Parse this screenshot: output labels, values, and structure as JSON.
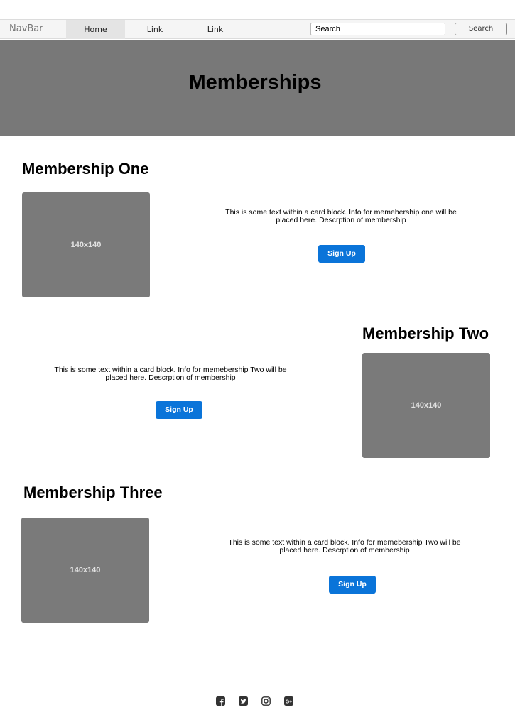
{
  "navbar": {
    "brand": "NavBar",
    "items": [
      {
        "label": "Home"
      },
      {
        "label": "Link"
      },
      {
        "label": "Link"
      }
    ],
    "search_placeholder": "Search",
    "search_button": "Search"
  },
  "hero": {
    "title": "Memberships"
  },
  "memberships": [
    {
      "title": "Membership One",
      "image_label": "140x140",
      "text": "This is some text within a card block. Info for memebership one will be placed here. Descrption of membership",
      "button": "Sign Up"
    },
    {
      "title": "Membership Two",
      "image_label": "140x140",
      "text": "This is some text within a card block. Info for memebership Two will be placed here. Descrption of membership",
      "button": "Sign Up"
    },
    {
      "title": "Membership Three",
      "image_label": "140x140",
      "text": "This is some text within a card block. Info for memebership Two will be placed here. Descrption of membership",
      "button": "Sign Up"
    }
  ],
  "footer": {
    "icons": [
      "facebook-icon",
      "twitter-icon",
      "instagram-icon",
      "google-plus-icon"
    ]
  }
}
